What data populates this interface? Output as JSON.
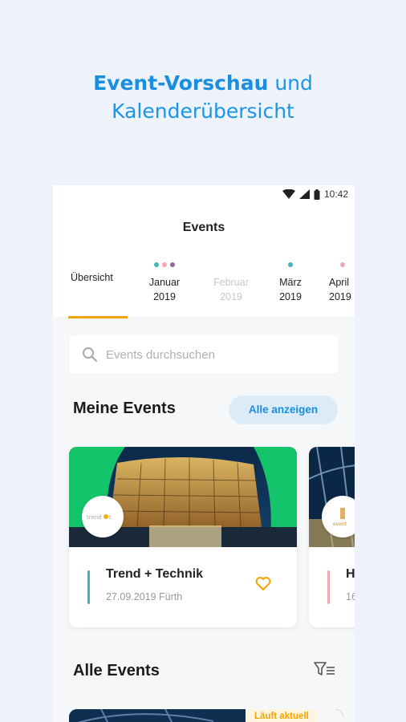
{
  "headline": {
    "strong": "Event-Vorschau",
    "rest": " und",
    "line2": "Kalenderübersicht"
  },
  "status": {
    "time": "10:42"
  },
  "app": {
    "title": "Events"
  },
  "tabs": [
    {
      "line1": "Übersicht",
      "line2": "",
      "active": true
    },
    {
      "line1": "Januar",
      "line2": "2019",
      "dots": [
        "#3fb3bf",
        "#f3a6b6",
        "#8e6a9a"
      ]
    },
    {
      "line1": "Februar",
      "line2": "2019",
      "disabled": true
    },
    {
      "line1": "März",
      "line2": "2019",
      "dots": [
        "#3fb3bf"
      ]
    },
    {
      "line1": "April",
      "line2": "2019",
      "dots": [
        "#f3a6b6"
      ]
    }
  ],
  "search": {
    "placeholder": "Events durchsuchen"
  },
  "my_events": {
    "title": "Meine Events",
    "all_label": "Alle anzeigen"
  },
  "cards": [
    {
      "title": "Trend + Technik",
      "date_place": "27.09.2019 Fürth",
      "accent": "#3fb3bf",
      "heart_color": "#f2a400"
    },
    {
      "title": "H",
      "date_place": "16",
      "accent": "#f3a6b6"
    }
  ],
  "all_events": {
    "title": "Alle Events",
    "badge": "Läuft aktuell"
  },
  "colors": {
    "accent_blue": "#1a8ee0",
    "accent_orange": "#f2a400"
  }
}
